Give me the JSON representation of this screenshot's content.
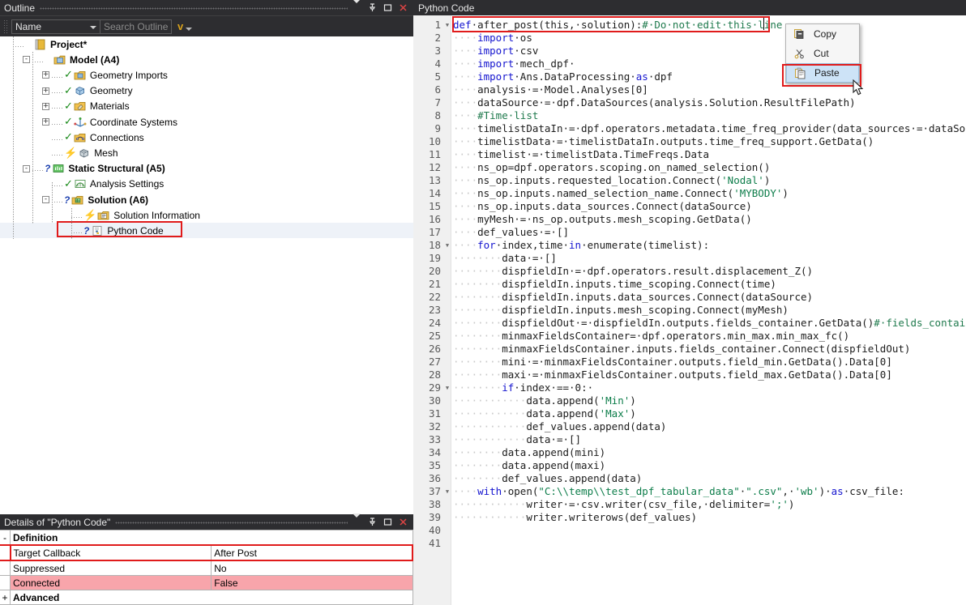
{
  "outline_panel": {
    "title": "Outline",
    "title_buttons": [
      "caret-down",
      "pin",
      "maximize",
      "close"
    ],
    "toolbar": {
      "combo_value": "Name",
      "search_placeholder": "Search Outline",
      "chevron": "v"
    },
    "tree": [
      {
        "label": "Project*",
        "depth": 0,
        "bold": true,
        "expander": "",
        "status": "",
        "icon": "project-icon"
      },
      {
        "label": "Model (A4)",
        "depth": 1,
        "bold": true,
        "expander": "-",
        "status": "",
        "icon": "model-icon"
      },
      {
        "label": "Geometry Imports",
        "depth": 2,
        "bold": false,
        "expander": "+",
        "status": "check",
        "icon": "folder-geometry-icon"
      },
      {
        "label": "Geometry",
        "depth": 2,
        "bold": false,
        "expander": "+",
        "status": "check",
        "icon": "geometry-icon"
      },
      {
        "label": "Materials",
        "depth": 2,
        "bold": false,
        "expander": "+",
        "status": "check",
        "icon": "materials-icon"
      },
      {
        "label": "Coordinate Systems",
        "depth": 2,
        "bold": false,
        "expander": "+",
        "status": "check",
        "icon": "coordinate-systems-icon"
      },
      {
        "label": "Connections",
        "depth": 2,
        "bold": false,
        "expander": "",
        "status": "check",
        "icon": "connections-icon"
      },
      {
        "label": "Mesh",
        "depth": 2,
        "bold": false,
        "expander": "",
        "status": "bolt",
        "icon": "mesh-icon"
      },
      {
        "label": "Static Structural (A5)",
        "depth": 1,
        "bold": true,
        "expander": "-",
        "status": "question",
        "icon": "static-structural-icon"
      },
      {
        "label": "Analysis Settings",
        "depth": 2,
        "bold": false,
        "expander": "",
        "status": "check",
        "icon": "analysis-settings-icon"
      },
      {
        "label": "Solution (A6)",
        "depth": 2,
        "bold": true,
        "expander": "-",
        "status": "question",
        "icon": "solution-icon"
      },
      {
        "label": "Solution Information",
        "depth": 3,
        "bold": false,
        "expander": "",
        "status": "bolt",
        "icon": "solution-information-icon"
      },
      {
        "label": "Python Code",
        "depth": 3,
        "bold": false,
        "expander": "",
        "status": "question",
        "icon": "python-code-icon",
        "highlighted": true,
        "selected": true
      }
    ]
  },
  "details_panel": {
    "title": "Details of \"Python Code\"",
    "title_buttons": [
      "caret-down",
      "pin",
      "maximize",
      "close"
    ],
    "rows": [
      {
        "type": "group",
        "expander": "-",
        "label": "Definition"
      },
      {
        "type": "prop",
        "label": "Target Callback",
        "value": "After Post",
        "highlighted": true
      },
      {
        "type": "prop",
        "label": "Suppressed",
        "value": "No"
      },
      {
        "type": "prop",
        "label": "Connected",
        "value": "False",
        "pink": true
      },
      {
        "type": "group",
        "expander": "+",
        "label": "Advanced"
      }
    ]
  },
  "code_panel": {
    "title": "Python Code",
    "line_count_visible": 41,
    "lines": [
      {
        "n": 1,
        "fold": "-",
        "indent": 0,
        "tokens": [
          {
            "t": "def",
            "c": "kw"
          },
          {
            "t": " after_post(this, solution):",
            "c": ""
          },
          {
            "t": "# Do not edit this line",
            "c": "cm"
          }
        ],
        "boxed": true,
        "caret": true
      },
      {
        "n": 2,
        "fold": "",
        "indent": 1,
        "tokens": [
          {
            "t": "import",
            "c": "kw"
          },
          {
            "t": " os",
            "c": ""
          }
        ]
      },
      {
        "n": 3,
        "fold": "",
        "indent": 1,
        "tokens": [
          {
            "t": "import",
            "c": "kw"
          },
          {
            "t": " csv",
            "c": ""
          }
        ]
      },
      {
        "n": 4,
        "fold": "",
        "indent": 1,
        "tokens": [
          {
            "t": "import",
            "c": "kw"
          },
          {
            "t": " mech_dpf ",
            "c": ""
          }
        ]
      },
      {
        "n": 5,
        "fold": "",
        "indent": 1,
        "tokens": [
          {
            "t": "import",
            "c": "kw"
          },
          {
            "t": " Ans.DataProcessing ",
            "c": ""
          },
          {
            "t": "as",
            "c": "kw"
          },
          {
            "t": " dpf",
            "c": ""
          }
        ]
      },
      {
        "n": 6,
        "fold": "",
        "indent": 1,
        "tokens": [
          {
            "t": "analysis = Model.Analyses[0]",
            "c": ""
          }
        ]
      },
      {
        "n": 7,
        "fold": "",
        "indent": 1,
        "tokens": [
          {
            "t": "dataSource = dpf.DataSources(analysis.Solution.ResultFilePath)",
            "c": ""
          }
        ]
      },
      {
        "n": 8,
        "fold": "",
        "indent": 1,
        "tokens": [
          {
            "t": "#Time list",
            "c": "cm"
          }
        ]
      },
      {
        "n": 9,
        "fold": "",
        "indent": 1,
        "tokens": [
          {
            "t": "timelistDataIn = dpf.operators.metadata.time_freq_provider(data_sources = dataSource)",
            "c": ""
          }
        ]
      },
      {
        "n": 10,
        "fold": "",
        "indent": 1,
        "tokens": [
          {
            "t": "timelistData = timelistDataIn.outputs.time_freq_support.GetData()",
            "c": ""
          }
        ]
      },
      {
        "n": 11,
        "fold": "",
        "indent": 1,
        "tokens": [
          {
            "t": "timelist = timelistData.TimeFreqs.Data",
            "c": ""
          }
        ]
      },
      {
        "n": 12,
        "fold": "",
        "indent": 1,
        "tokens": [
          {
            "t": "ns_op=dpf.operators.scoping.on_named_selection()",
            "c": ""
          }
        ]
      },
      {
        "n": 13,
        "fold": "",
        "indent": 1,
        "tokens": [
          {
            "t": "ns_op.inputs.requested_location.Connect(",
            "c": ""
          },
          {
            "t": "'Nodal'",
            "c": "str"
          },
          {
            "t": ")",
            "c": ""
          }
        ]
      },
      {
        "n": 14,
        "fold": "",
        "indent": 1,
        "tokens": [
          {
            "t": "ns_op.inputs.named_selection_name.Connect(",
            "c": ""
          },
          {
            "t": "'MYBODY'",
            "c": "str"
          },
          {
            "t": ")",
            "c": ""
          }
        ]
      },
      {
        "n": 15,
        "fold": "",
        "indent": 1,
        "tokens": [
          {
            "t": "ns_op.inputs.data_sources.Connect(dataSource)",
            "c": ""
          }
        ]
      },
      {
        "n": 16,
        "fold": "",
        "indent": 1,
        "tokens": [
          {
            "t": "myMesh = ns_op.outputs.mesh_scoping.GetData()",
            "c": ""
          }
        ]
      },
      {
        "n": 17,
        "fold": "",
        "indent": 1,
        "tokens": [
          {
            "t": "def_values = []",
            "c": ""
          }
        ]
      },
      {
        "n": 18,
        "fold": "-",
        "indent": 1,
        "tokens": [
          {
            "t": "for",
            "c": "kw"
          },
          {
            "t": " index,time ",
            "c": ""
          },
          {
            "t": "in",
            "c": "kw"
          },
          {
            "t": " enumerate(timelist):",
            "c": ""
          }
        ]
      },
      {
        "n": 19,
        "fold": "",
        "indent": 2,
        "tokens": [
          {
            "t": "data = []",
            "c": ""
          }
        ]
      },
      {
        "n": 20,
        "fold": "",
        "indent": 2,
        "tokens": [
          {
            "t": "dispfieldIn = dpf.operators.result.displacement_Z()",
            "c": ""
          }
        ]
      },
      {
        "n": 21,
        "fold": "",
        "indent": 2,
        "tokens": [
          {
            "t": "dispfieldIn.inputs.time_scoping.Connect(time)",
            "c": ""
          }
        ]
      },
      {
        "n": 22,
        "fold": "",
        "indent": 2,
        "tokens": [
          {
            "t": "dispfieldIn.inputs.data_sources.Connect(dataSource)",
            "c": ""
          }
        ]
      },
      {
        "n": 23,
        "fold": "",
        "indent": 2,
        "tokens": [
          {
            "t": "dispfieldIn.inputs.mesh_scoping.Connect(myMesh)",
            "c": ""
          }
        ]
      },
      {
        "n": 24,
        "fold": "",
        "indent": 2,
        "tokens": [
          {
            "t": "dispfieldOut = dispfieldIn.outputs.fields_container.GetData()",
            "c": ""
          },
          {
            "t": "# fields_container",
            "c": "cm"
          }
        ]
      },
      {
        "n": 25,
        "fold": "",
        "indent": 2,
        "tokens": [
          {
            "t": "minmaxFieldsContainer= dpf.operators.min_max.min_max_fc()",
            "c": ""
          }
        ]
      },
      {
        "n": 26,
        "fold": "",
        "indent": 2,
        "tokens": [
          {
            "t": "minmaxFieldsContainer.inputs.fields_container.Connect(dispfieldOut)",
            "c": ""
          }
        ]
      },
      {
        "n": 27,
        "fold": "",
        "indent": 2,
        "tokens": [
          {
            "t": "mini = minmaxFieldsContainer.outputs.field_min.GetData().Data[0]",
            "c": ""
          }
        ]
      },
      {
        "n": 28,
        "fold": "",
        "indent": 2,
        "tokens": [
          {
            "t": "maxi = minmaxFieldsContainer.outputs.field_max.GetData().Data[0]",
            "c": ""
          }
        ]
      },
      {
        "n": 29,
        "fold": "-",
        "indent": 2,
        "tokens": [
          {
            "t": "if",
            "c": "kw"
          },
          {
            "t": " index == 0: ",
            "c": ""
          }
        ]
      },
      {
        "n": 30,
        "fold": "",
        "indent": 3,
        "tokens": [
          {
            "t": "data.append(",
            "c": ""
          },
          {
            "t": "'Min'",
            "c": "str"
          },
          {
            "t": ")",
            "c": ""
          }
        ]
      },
      {
        "n": 31,
        "fold": "",
        "indent": 3,
        "tokens": [
          {
            "t": "data.append(",
            "c": ""
          },
          {
            "t": "'Max'",
            "c": "str"
          },
          {
            "t": ")",
            "c": ""
          }
        ]
      },
      {
        "n": 32,
        "fold": "",
        "indent": 3,
        "tokens": [
          {
            "t": "def_values.append(data)",
            "c": ""
          }
        ]
      },
      {
        "n": 33,
        "fold": "",
        "indent": 3,
        "tokens": [
          {
            "t": "data = []",
            "c": ""
          }
        ]
      },
      {
        "n": 34,
        "fold": "",
        "indent": 2,
        "tokens": [
          {
            "t": "data.append(mini)",
            "c": ""
          }
        ]
      },
      {
        "n": 35,
        "fold": "",
        "indent": 2,
        "tokens": [
          {
            "t": "data.append(maxi)",
            "c": ""
          }
        ]
      },
      {
        "n": 36,
        "fold": "",
        "indent": 2,
        "tokens": [
          {
            "t": "def_values.append(data)",
            "c": ""
          }
        ]
      },
      {
        "n": 37,
        "fold": "-",
        "indent": 1,
        "tokens": [
          {
            "t": "with",
            "c": "kw"
          },
          {
            "t": " open(",
            "c": ""
          },
          {
            "t": "\"C:\\\\temp\\\\test_dpf_tabular_data\"",
            "c": "str"
          },
          {
            "t": " ",
            "c": ""
          },
          {
            "t": "\".csv\"",
            "c": "str"
          },
          {
            "t": ", ",
            "c": ""
          },
          {
            "t": "'wb'",
            "c": "str"
          },
          {
            "t": ") ",
            "c": ""
          },
          {
            "t": "as",
            "c": "kw"
          },
          {
            "t": " csv_file:",
            "c": ""
          }
        ]
      },
      {
        "n": 38,
        "fold": "",
        "indent": 3,
        "tokens": [
          {
            "t": "writer = csv.writer(csv_file, delimiter=",
            "c": ""
          },
          {
            "t": "';'",
            "c": "str"
          },
          {
            "t": ")",
            "c": ""
          }
        ]
      },
      {
        "n": 39,
        "fold": "",
        "indent": 3,
        "tokens": [
          {
            "t": "writer.writerows(def_values)",
            "c": ""
          }
        ]
      },
      {
        "n": 40,
        "fold": "",
        "indent": 0,
        "tokens": []
      },
      {
        "n": 41,
        "fold": "",
        "indent": 0,
        "tokens": []
      }
    ]
  },
  "context_menu": {
    "items": [
      {
        "label": "Copy",
        "icon": "copy-icon",
        "selected": false
      },
      {
        "label": "Cut",
        "icon": "cut-icon",
        "selected": false
      },
      {
        "label": "Paste",
        "icon": "paste-icon",
        "selected": true,
        "highlighted": true
      }
    ]
  },
  "colors": {
    "title_bar_bg": "#2d2d30",
    "title_bar_fg": "#e6e6e6",
    "highlight_red": "#e01b1b",
    "menu_selection": "#cde3f7",
    "pink_row": "#f8a5ab",
    "keyword_blue": "#1414cf",
    "string_green": "#0d7d4a",
    "comment_green": "#1f7a4d",
    "gutter_bg": "#f0f0f0"
  }
}
